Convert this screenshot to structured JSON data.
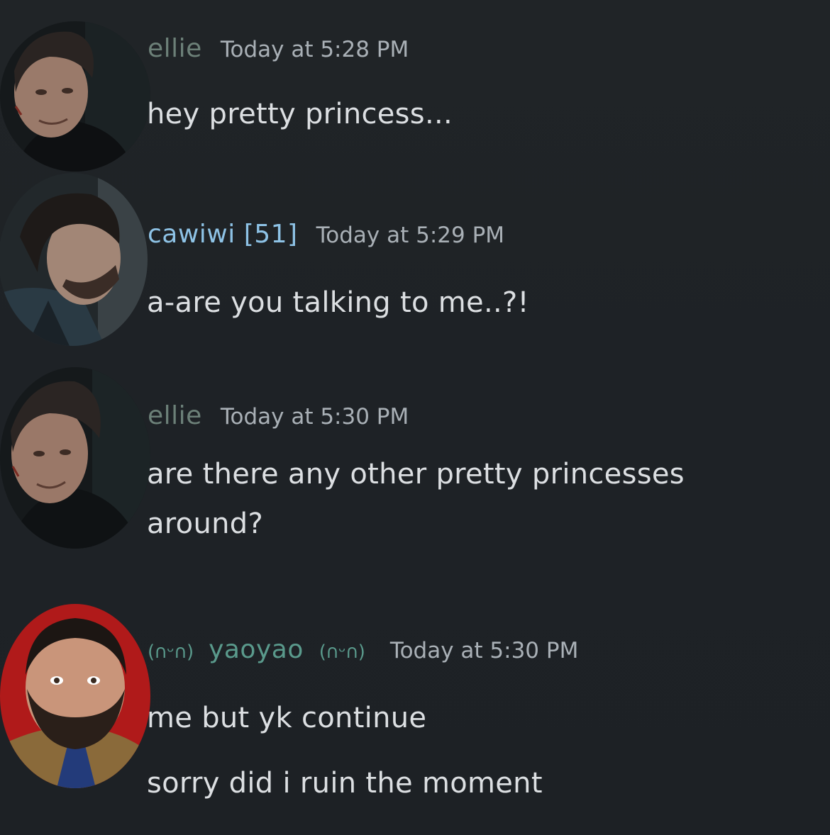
{
  "messages": [
    {
      "username": "ellie",
      "username_color": "#6c8078",
      "timestamp": "Today at 5:28 PM",
      "avatar": "man-portrait-avatar",
      "lines": [
        "hey pretty princess..."
      ]
    },
    {
      "username": "cawiwi [51]",
      "username_color": "#8ec3e6",
      "timestamp": "Today at 5:29 PM",
      "avatar": "man-profile-avatar",
      "lines": [
        "a-are you talking to me..?!"
      ]
    },
    {
      "username": "ellie",
      "username_color": "#6c8078",
      "timestamp": "Today at 5:30 PM",
      "avatar": "man-portrait-avatar",
      "lines": [
        "are there any other pretty princesses",
        "around?"
      ]
    },
    {
      "username_prefix": "(∩ᵕ∩)",
      "username": "yaoyao",
      "username_suffix": "(∩ᵕ∩)",
      "username_color": "#5a9a8c",
      "timestamp": "Today at 5:30 PM",
      "avatar": "bearded-man-avatar",
      "lines": [
        "me but yk continue",
        "sorry did i ruin the moment"
      ]
    }
  ]
}
